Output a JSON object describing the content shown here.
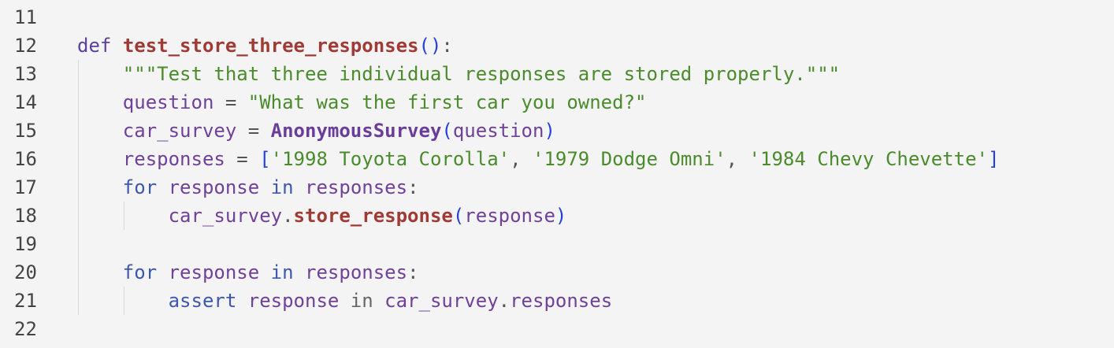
{
  "editor": {
    "lines": [
      {
        "num": "11",
        "tokens": []
      },
      {
        "num": "12",
        "tokens": [
          {
            "t": "def",
            "c": "kw"
          },
          {
            "t": " ",
            "c": ""
          },
          {
            "t": "test_store_three_responses",
            "c": "fn"
          },
          {
            "t": "()",
            "c": "br"
          },
          {
            "t": ":",
            "c": "op"
          }
        ]
      },
      {
        "num": "13",
        "tokens": [
          {
            "t": "    ",
            "c": ""
          },
          {
            "t": "\"\"\"Test that three individual responses are stored properly.\"\"\"",
            "c": "str"
          }
        ]
      },
      {
        "num": "14",
        "tokens": [
          {
            "t": "    ",
            "c": ""
          },
          {
            "t": "question",
            "c": "var"
          },
          {
            "t": " = ",
            "c": "op"
          },
          {
            "t": "\"What was the first car you owned?\"",
            "c": "str"
          }
        ]
      },
      {
        "num": "15",
        "tokens": [
          {
            "t": "    ",
            "c": ""
          },
          {
            "t": "car_survey",
            "c": "var"
          },
          {
            "t": " = ",
            "c": "op"
          },
          {
            "t": "AnonymousSurvey",
            "c": "cls"
          },
          {
            "t": "(",
            "c": "br"
          },
          {
            "t": "question",
            "c": "var"
          },
          {
            "t": ")",
            "c": "br"
          }
        ]
      },
      {
        "num": "16",
        "tokens": [
          {
            "t": "    ",
            "c": ""
          },
          {
            "t": "responses",
            "c": "var"
          },
          {
            "t": " = ",
            "c": "op"
          },
          {
            "t": "[",
            "c": "br"
          },
          {
            "t": "'1998 Toyota Corolla'",
            "c": "str"
          },
          {
            "t": ", ",
            "c": "op"
          },
          {
            "t": "'1979 Dodge Omni'",
            "c": "str"
          },
          {
            "t": ", ",
            "c": "op"
          },
          {
            "t": "'1984 Chevy Chevette'",
            "c": "str"
          },
          {
            "t": "]",
            "c": "br"
          }
        ]
      },
      {
        "num": "17",
        "tokens": [
          {
            "t": "    ",
            "c": ""
          },
          {
            "t": "for",
            "c": "ctl"
          },
          {
            "t": " ",
            "c": ""
          },
          {
            "t": "response",
            "c": "var"
          },
          {
            "t": " ",
            "c": ""
          },
          {
            "t": "in",
            "c": "ctl"
          },
          {
            "t": " ",
            "c": ""
          },
          {
            "t": "responses",
            "c": "var"
          },
          {
            "t": ":",
            "c": "op"
          }
        ]
      },
      {
        "num": "18",
        "tokens": [
          {
            "t": "        ",
            "c": ""
          },
          {
            "t": "car_survey",
            "c": "var"
          },
          {
            "t": ".",
            "c": "op"
          },
          {
            "t": "store_response",
            "c": "fn"
          },
          {
            "t": "(",
            "c": "br"
          },
          {
            "t": "response",
            "c": "var"
          },
          {
            "t": ")",
            "c": "br"
          }
        ]
      },
      {
        "num": "19",
        "tokens": []
      },
      {
        "num": "20",
        "tokens": [
          {
            "t": "    ",
            "c": ""
          },
          {
            "t": "for",
            "c": "ctl"
          },
          {
            "t": " ",
            "c": ""
          },
          {
            "t": "response",
            "c": "var"
          },
          {
            "t": " ",
            "c": ""
          },
          {
            "t": "in",
            "c": "ctl"
          },
          {
            "t": " ",
            "c": ""
          },
          {
            "t": "responses",
            "c": "var"
          },
          {
            "t": ":",
            "c": "op"
          }
        ]
      },
      {
        "num": "21",
        "tokens": [
          {
            "t": "        ",
            "c": ""
          },
          {
            "t": "assert",
            "c": "ctl"
          },
          {
            "t": " ",
            "c": ""
          },
          {
            "t": "response",
            "c": "var"
          },
          {
            "t": " ",
            "c": ""
          },
          {
            "t": "in",
            "c": "dim"
          },
          {
            "t": " ",
            "c": ""
          },
          {
            "t": "car_survey",
            "c": "var"
          },
          {
            "t": ".",
            "c": "op"
          },
          {
            "t": "responses",
            "c": "var"
          }
        ]
      },
      {
        "num": "22",
        "tokens": []
      }
    ]
  }
}
